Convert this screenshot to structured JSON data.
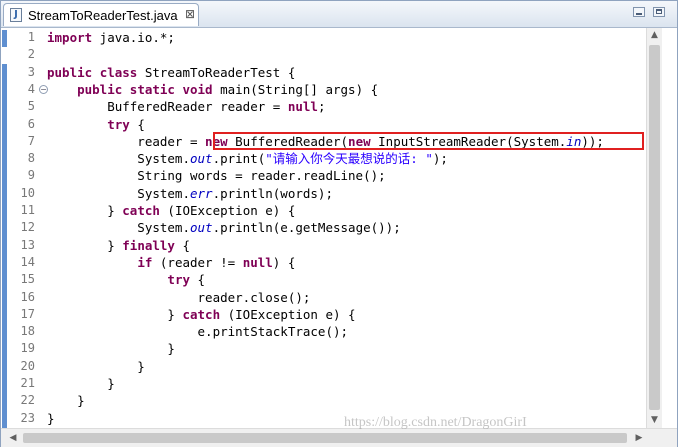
{
  "tab": {
    "title": "StreamToReaderTest.java",
    "close_glyph": "⊠",
    "icon_name": "java-file-icon",
    "icon_glyph": "J"
  },
  "colors": {
    "keyword": "#7f0055",
    "string": "#2a00ff",
    "static_field": "#0000c0",
    "highlight_box": "#e02020",
    "ruler_marker": "#5f8fd0"
  },
  "code_lines": [
    {
      "n": "1",
      "segments": [
        {
          "t": "kw",
          "v": "import"
        },
        {
          "t": "plain",
          "v": " java.io.*;"
        }
      ]
    },
    {
      "n": "2",
      "segments": []
    },
    {
      "n": "3",
      "segments": [
        {
          "t": "kw",
          "v": "public"
        },
        {
          "t": "plain",
          "v": " "
        },
        {
          "t": "kw",
          "v": "class"
        },
        {
          "t": "plain",
          "v": " StreamToReaderTest {"
        }
      ]
    },
    {
      "n": "4",
      "fold": true,
      "segments": [
        {
          "t": "plain",
          "v": "    "
        },
        {
          "t": "kw",
          "v": "public"
        },
        {
          "t": "plain",
          "v": " "
        },
        {
          "t": "kw",
          "v": "static"
        },
        {
          "t": "plain",
          "v": " "
        },
        {
          "t": "kw",
          "v": "void"
        },
        {
          "t": "plain",
          "v": " main(String[] args) {"
        }
      ]
    },
    {
      "n": "5",
      "segments": [
        {
          "t": "plain",
          "v": "        BufferedReader reader = "
        },
        {
          "t": "kw",
          "v": "null"
        },
        {
          "t": "plain",
          "v": ";"
        }
      ]
    },
    {
      "n": "6",
      "segments": [
        {
          "t": "plain",
          "v": "        "
        },
        {
          "t": "kw",
          "v": "try"
        },
        {
          "t": "plain",
          "v": " {"
        }
      ]
    },
    {
      "n": "7",
      "segments": [
        {
          "t": "plain",
          "v": "            reader = "
        },
        {
          "t": "kw",
          "v": "new"
        },
        {
          "t": "plain",
          "v": " BufferedReader("
        },
        {
          "t": "kw",
          "v": "new"
        },
        {
          "t": "plain",
          "v": " InputStreamReader(System."
        },
        {
          "t": "fld",
          "v": "in"
        },
        {
          "t": "plain",
          "v": "));"
        }
      ]
    },
    {
      "n": "8",
      "segments": [
        {
          "t": "plain",
          "v": "            System."
        },
        {
          "t": "fld",
          "v": "out"
        },
        {
          "t": "plain",
          "v": ".print("
        },
        {
          "t": "str",
          "v": "\"请输入你今天最想说的话: \""
        },
        {
          "t": "plain",
          "v": ");"
        }
      ]
    },
    {
      "n": "9",
      "segments": [
        {
          "t": "plain",
          "v": "            String words = reader.readLine();"
        }
      ]
    },
    {
      "n": "10",
      "segments": [
        {
          "t": "plain",
          "v": "            System."
        },
        {
          "t": "fld",
          "v": "err"
        },
        {
          "t": "plain",
          "v": ".println(words);"
        }
      ]
    },
    {
      "n": "11",
      "segments": [
        {
          "t": "plain",
          "v": "        } "
        },
        {
          "t": "kw",
          "v": "catch"
        },
        {
          "t": "plain",
          "v": " (IOException e) {"
        }
      ]
    },
    {
      "n": "12",
      "segments": [
        {
          "t": "plain",
          "v": "            System."
        },
        {
          "t": "fld",
          "v": "out"
        },
        {
          "t": "plain",
          "v": ".println(e.getMessage());"
        }
      ]
    },
    {
      "n": "13",
      "segments": [
        {
          "t": "plain",
          "v": "        } "
        },
        {
          "t": "kw",
          "v": "finally"
        },
        {
          "t": "plain",
          "v": " {"
        }
      ]
    },
    {
      "n": "14",
      "segments": [
        {
          "t": "plain",
          "v": "            "
        },
        {
          "t": "kw",
          "v": "if"
        },
        {
          "t": "plain",
          "v": " (reader != "
        },
        {
          "t": "kw",
          "v": "null"
        },
        {
          "t": "plain",
          "v": ") {"
        }
      ]
    },
    {
      "n": "15",
      "segments": [
        {
          "t": "plain",
          "v": "                "
        },
        {
          "t": "kw",
          "v": "try"
        },
        {
          "t": "plain",
          "v": " {"
        }
      ]
    },
    {
      "n": "16",
      "segments": [
        {
          "t": "plain",
          "v": "                    reader.close();"
        }
      ]
    },
    {
      "n": "17",
      "segments": [
        {
          "t": "plain",
          "v": "                } "
        },
        {
          "t": "kw",
          "v": "catch"
        },
        {
          "t": "plain",
          "v": " (IOException e) {"
        }
      ]
    },
    {
      "n": "18",
      "segments": [
        {
          "t": "plain",
          "v": "                    e.printStackTrace();"
        }
      ]
    },
    {
      "n": "19",
      "segments": [
        {
          "t": "plain",
          "v": "                }"
        }
      ]
    },
    {
      "n": "20",
      "segments": [
        {
          "t": "plain",
          "v": "            }"
        }
      ]
    },
    {
      "n": "21",
      "segments": [
        {
          "t": "plain",
          "v": "        }"
        }
      ]
    },
    {
      "n": "22",
      "segments": [
        {
          "t": "plain",
          "v": "    }"
        }
      ]
    },
    {
      "n": "23",
      "segments": [
        {
          "t": "plain",
          "v": "}"
        }
      ]
    }
  ],
  "highlighted_line": "7",
  "watermark": "https://blog.csdn.net/DragonGirI"
}
